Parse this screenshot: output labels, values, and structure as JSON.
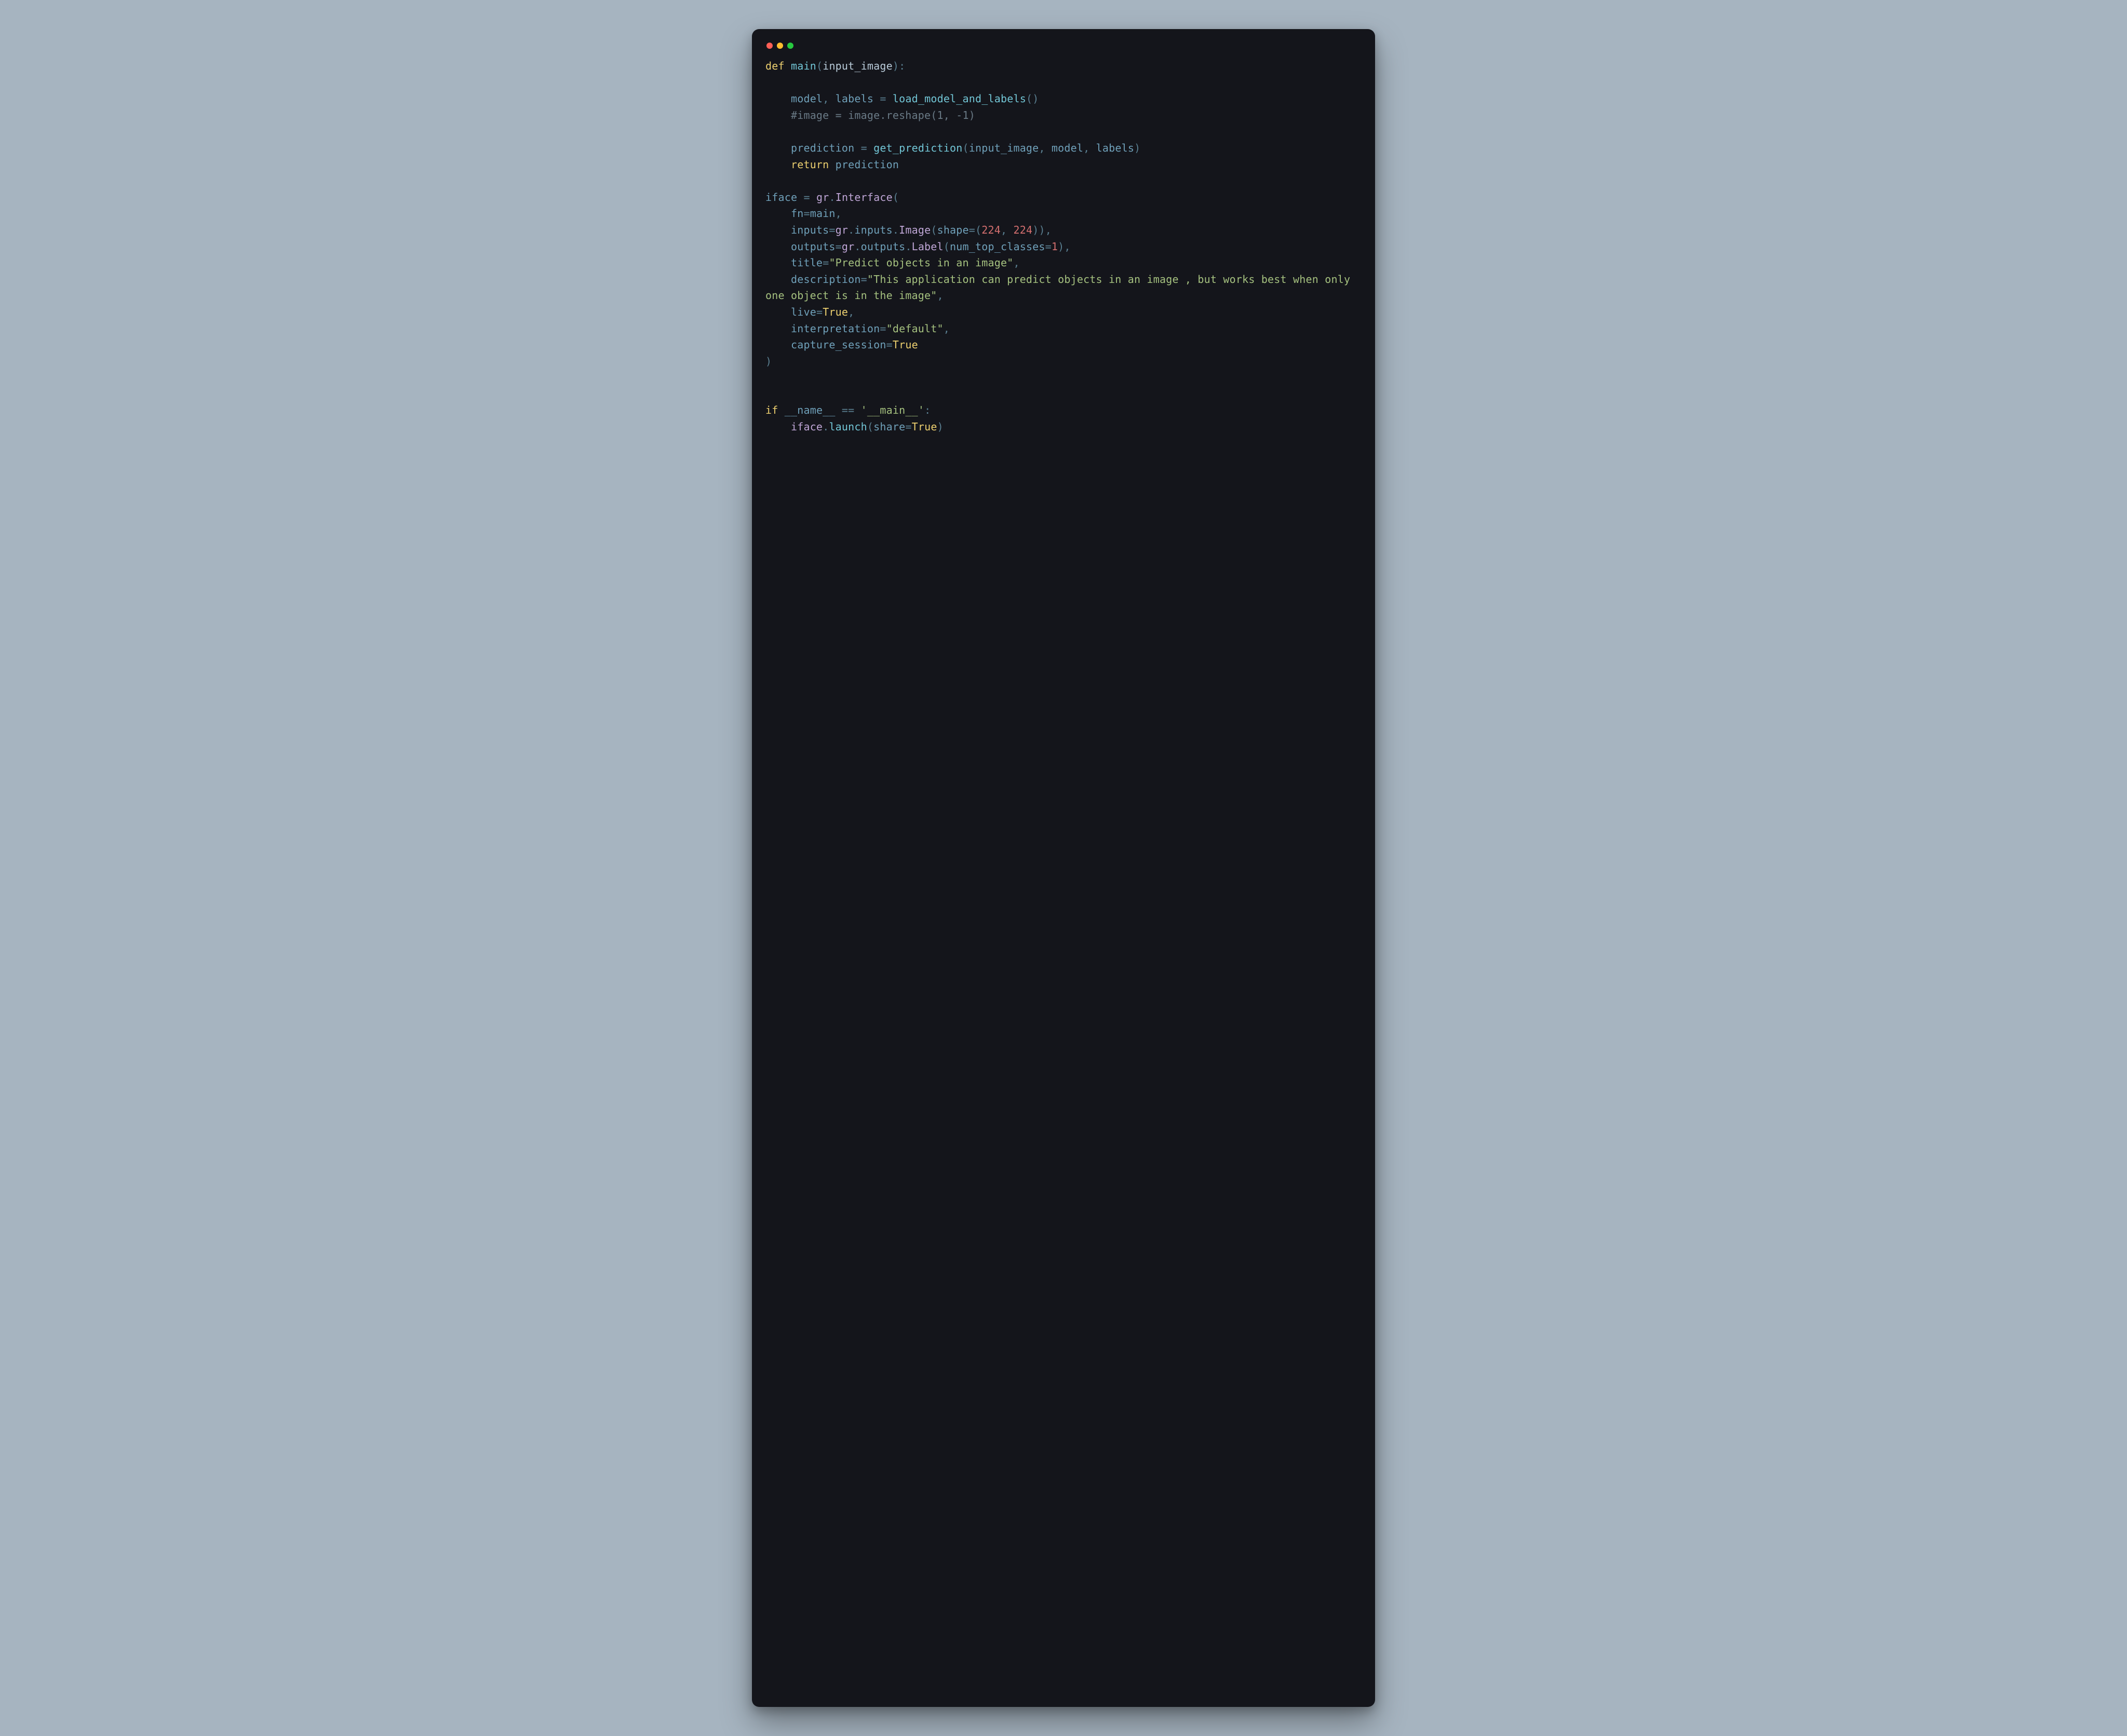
{
  "traffic": {
    "red": "#ff5f56",
    "yellow": "#ffbd2e",
    "green": "#27c93f"
  },
  "code": {
    "kw_def": "def",
    "kw_return": "return",
    "kw_if": "if",
    "fn_main": "main",
    "p_input_image": "input_image",
    "sym_open": "(",
    "sym_close": ")",
    "sym_colon": ":",
    "sym_comma": ",",
    "sym_dot": ".",
    "sym_eq": "=",
    "sym_eqeq": "==",
    "id_model": "model",
    "id_labels": "labels",
    "fn_load": "load_model_and_labels",
    "c_reshape": "#image = image.reshape(1, -1)",
    "id_prediction": "prediction",
    "fn_get_prediction": "get_prediction",
    "id_iface": "iface",
    "id_gr": "gr",
    "cls_Interface": "Interface",
    "kw_fn": "fn",
    "kw_inputs": "inputs",
    "sub_inputs": "inputs",
    "cls_Image": "Image",
    "kw_shape": "shape",
    "n_224a": "224",
    "n_224b": "224",
    "kw_outputs": "outputs",
    "sub_outputs": "outputs",
    "cls_Label": "Label",
    "kw_num_top_classes": "num_top_classes",
    "n_1": "1",
    "kw_title": "title",
    "s_title": "\"Predict objects in an image\"",
    "kw_description": "description",
    "s_desc": "\"This application can predict objects in an image , but works best when only one object is in the image\"",
    "kw_live": "live",
    "kw_interpretation": "interpretation",
    "s_default": "\"default\"",
    "kw_capture_session": "capture_session",
    "bool_true": "True",
    "id_name": "__name__",
    "s_mainlit": "'__main__'",
    "fn_launch": "launch",
    "kw_share": "share"
  }
}
